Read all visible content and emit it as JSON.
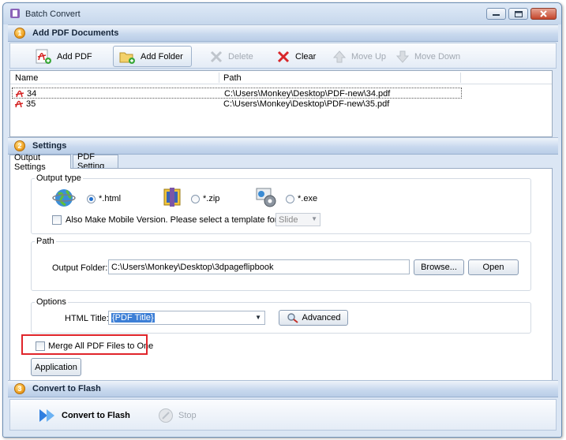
{
  "window": {
    "title": "Batch Convert"
  },
  "sections": {
    "add_pdf": {
      "number": "1",
      "title": "Add PDF Documents"
    },
    "settings": {
      "number": "2",
      "title": "Settings"
    },
    "convert": {
      "number": "3",
      "title": "Convert to Flash"
    }
  },
  "toolbar": {
    "add_pdf": "Add PDF",
    "add_folder": "Add Folder",
    "delete": "Delete",
    "clear": "Clear",
    "move_up": "Move Up",
    "move_down": "Move Down"
  },
  "file_list": {
    "columns": [
      "Name",
      "Path"
    ],
    "rows": [
      {
        "name": "34",
        "path": "C:\\Users\\Monkey\\Desktop\\PDF-new\\34.pdf",
        "selected": true
      },
      {
        "name": "35",
        "path": "C:\\Users\\Monkey\\Desktop\\PDF-new\\35.pdf",
        "selected": false
      }
    ]
  },
  "tabs": [
    {
      "label": "Output Settings",
      "active": true
    },
    {
      "label": "PDF Setting",
      "active": false
    }
  ],
  "output_type": {
    "group_label": "Output type",
    "options": [
      {
        "label": "*.html",
        "checked": true,
        "icon": "globe-icon"
      },
      {
        "label": "*.zip",
        "checked": false,
        "icon": "zip-archive-icon"
      },
      {
        "label": "*.exe",
        "checked": false,
        "icon": "exe-gear-icon"
      }
    ],
    "mobile_label": "Also Make Mobile Version. Please select a template for mobile:",
    "mobile_checked": false,
    "mobile_template": "Slide"
  },
  "path": {
    "group_label": "Path",
    "output_folder_label": "Output Folder:",
    "output_folder_value": "C:\\Users\\Monkey\\Desktop\\3dpageflipbook",
    "browse": "Browse...",
    "open": "Open"
  },
  "options": {
    "group_label": "Options",
    "html_title_label": "HTML Title:",
    "html_title_value": "{PDF Title}",
    "advanced": "Advanced"
  },
  "merge": {
    "label": "Merge All PDF Files to One",
    "checked": false
  },
  "application_button": "Application",
  "bottom": {
    "convert": "Convert to Flash",
    "stop": "Stop"
  },
  "colors": {
    "highlight": "#e0252b",
    "accent_blue": "#1f6fcf",
    "section_orange": "#f0a324"
  }
}
